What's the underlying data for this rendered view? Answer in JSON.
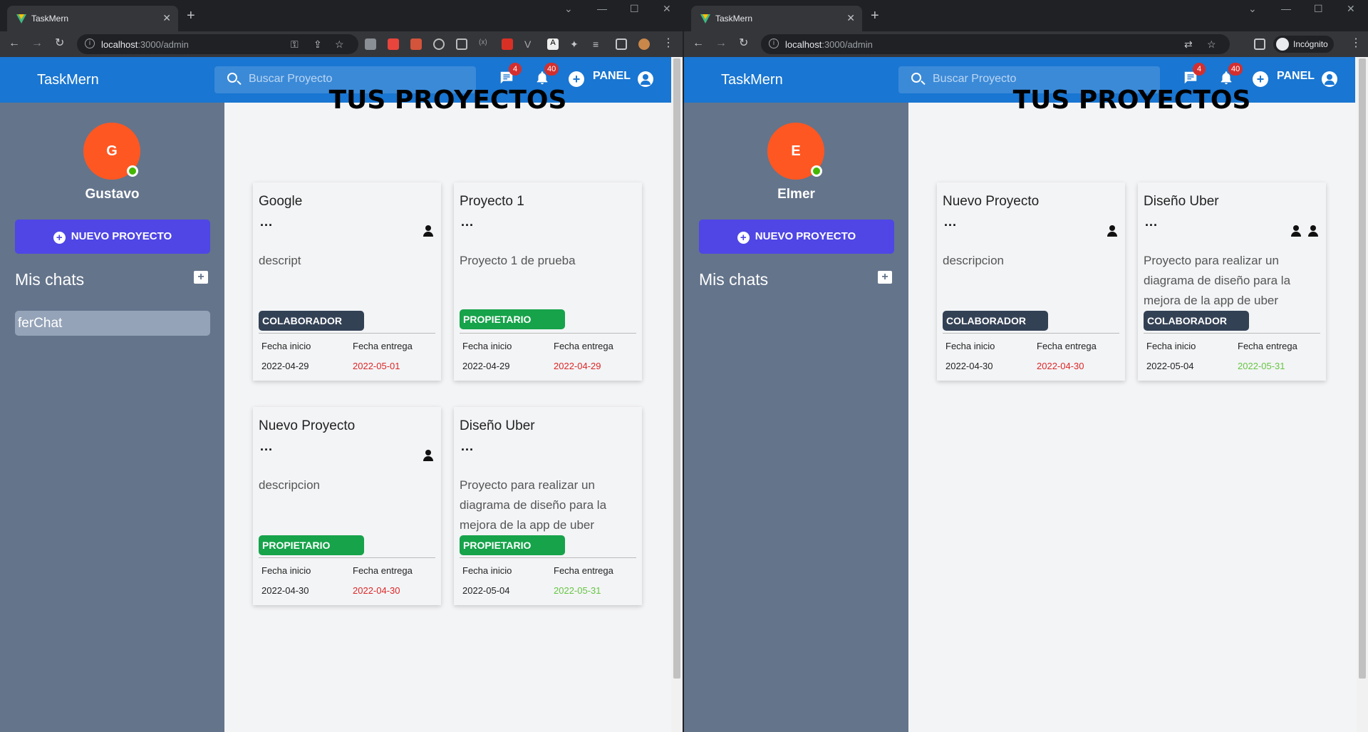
{
  "browser_left": {
    "tab_title": "TaskMern",
    "url_host": "localhost",
    "url_path": ":3000/admin"
  },
  "browser_right": {
    "tab_title": "TaskMern",
    "url_host": "localhost",
    "url_path": ":3000/admin",
    "incognito_label": "Incógnito"
  },
  "app": {
    "brand": "TaskMern",
    "search_placeholder": "Buscar Proyecto",
    "messages_badge": "4",
    "notifications_badge": "40",
    "panel_label": "PANEL",
    "main_title": "TUS PROYECTOS",
    "new_project_label": "NUEVO PROYECTO",
    "chats_title": "Mis chats",
    "date_start_label": "Fecha inicio",
    "date_end_label": "Fecha entrega",
    "colors": {
      "appbar": "#1976d2",
      "sidebar": "#64748b",
      "new_project": "#4f46e5",
      "colaborador": "#334155",
      "propietario": "#16a34a",
      "overdue": "#dc2626",
      "ontime": "#65c542"
    }
  },
  "left_user": {
    "initial": "G",
    "name": "Gustavo",
    "chats": [
      "ferChat"
    ],
    "projects": [
      {
        "title": "Google",
        "description": "descript",
        "role": "COLABORADOR",
        "members": 1,
        "start": "2022-04-29",
        "due": "2022-05-01",
        "due_status": "overdue"
      },
      {
        "title": "Proyecto 1",
        "description": "Proyecto 1 de prueba",
        "role": "PROPIETARIO",
        "members": 0,
        "start": "2022-04-29",
        "due": "2022-04-29",
        "due_status": "overdue"
      },
      {
        "title": "Nuevo Proyecto",
        "description": "descripcion",
        "role": "PROPIETARIO",
        "members": 1,
        "start": "2022-04-30",
        "due": "2022-04-30",
        "due_status": "overdue"
      },
      {
        "title": "Diseño Uber",
        "description": "Proyecto para realizar un diagrama de diseño para la mejora de la app de uber",
        "role": "PROPIETARIO",
        "members": 0,
        "start": "2022-05-04",
        "due": "2022-05-31",
        "due_status": "ontime"
      }
    ]
  },
  "right_user": {
    "initial": "E",
    "name": "Elmer",
    "chats": [],
    "projects": [
      {
        "title": "Nuevo Proyecto",
        "description": "descripcion",
        "role": "COLABORADOR",
        "members": 1,
        "start": "2022-04-30",
        "due": "2022-04-30",
        "due_status": "overdue"
      },
      {
        "title": "Diseño Uber",
        "description": "Proyecto para realizar un diagrama de diseño para la mejora de la app de uber",
        "role": "COLABORADOR",
        "members": 2,
        "start": "2022-05-04",
        "due": "2022-05-31",
        "due_status": "ontime"
      }
    ]
  }
}
